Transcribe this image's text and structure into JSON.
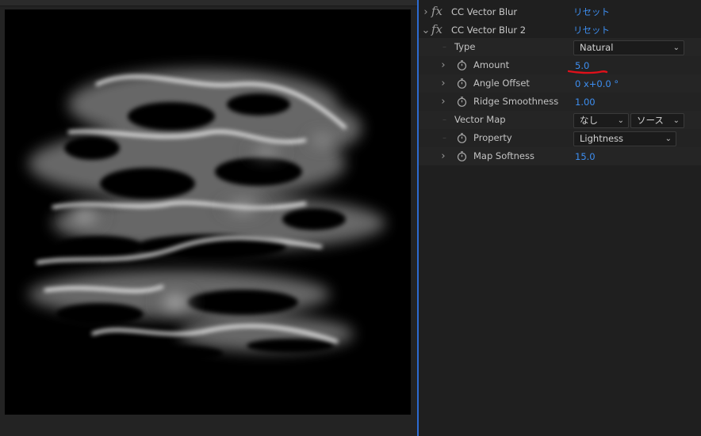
{
  "effects": [
    {
      "name": "CC Vector Blur",
      "reset_label": "リセット",
      "expanded": false
    },
    {
      "name": "CC Vector Blur 2",
      "reset_label": "リセット",
      "expanded": true
    }
  ],
  "fx_symbol": "fx",
  "properties": {
    "type": {
      "label": "Type",
      "value": "Natural"
    },
    "amount": {
      "label": "Amount",
      "value": "5.0"
    },
    "angle_offset": {
      "label": "Angle Offset",
      "value": "0 x+0.0 °"
    },
    "ridge_smoothness": {
      "label": "Ridge Smoothness",
      "value": "1.00"
    },
    "vector_map": {
      "label": "Vector Map",
      "layer_value": "なし",
      "source_value": "ソース"
    },
    "property": {
      "label": "Property",
      "value": "Lightness"
    },
    "map_softness": {
      "label": "Map Softness",
      "value": "15.0"
    }
  },
  "icons": {
    "twirl_collapsed": "chevron-right-icon",
    "twirl_expanded": "chevron-down-icon",
    "stopwatch": "stopwatch-icon",
    "dropdown": "chevron-down-icon"
  },
  "colors": {
    "value_blue": "#3d8ef0",
    "annotation_red": "#e0101a",
    "panel_divider": "#2d6bd0"
  }
}
